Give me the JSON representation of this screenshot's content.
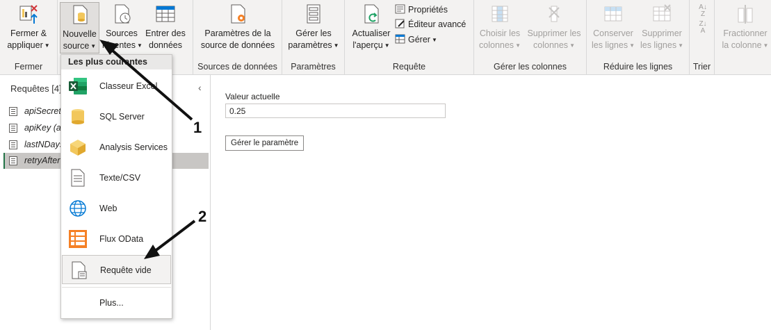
{
  "ribbon": {
    "groups": [
      {
        "label": "Fermer"
      },
      {
        "label": ""
      },
      {
        "label": "Sources de données"
      },
      {
        "label": "Paramètres"
      },
      {
        "label": "Requête"
      },
      {
        "label": "Gérer les colonnes"
      },
      {
        "label": "Réduire les lignes"
      },
      {
        "label": "Trier"
      }
    ],
    "close_apply": {
      "line1": "Fermer &",
      "line2": "appliquer"
    },
    "new_source": {
      "line1": "Nouvelle",
      "line2": "source"
    },
    "recent_sources": {
      "line1": "Sources",
      "line2": "récentes"
    },
    "enter_data": {
      "line1": "Entrer des",
      "line2": "données"
    },
    "ds_settings": {
      "line1": "Paramètres de la",
      "line2": "source de données"
    },
    "manage_params": {
      "line1": "Gérer les",
      "line2": "paramètres"
    },
    "refresh": {
      "line1": "Actualiser",
      "line2": "l'aperçu"
    },
    "properties": "Propriétés",
    "advanced_editor": "Éditeur avancé",
    "manage": "Gérer",
    "choose_cols": {
      "line1": "Choisir les",
      "line2": "colonnes"
    },
    "remove_cols": {
      "line1": "Supprimer les",
      "line2": "colonnes"
    },
    "keep_rows": {
      "line1": "Conserver",
      "line2": "les lignes"
    },
    "remove_rows": {
      "line1": "Supprimer",
      "line2": "les lignes"
    },
    "split_col": {
      "line1": "Fractionner",
      "line2": "la colonne"
    }
  },
  "queries_pane": {
    "title": "Requêtes [4]",
    "items": [
      {
        "label": "apiSecret ("
      },
      {
        "label": "apiKey (ap"
      },
      {
        "label": "lastNDays"
      },
      {
        "label": "retryAfter"
      }
    ]
  },
  "main": {
    "current_value_label": "Valeur actuelle",
    "current_value": "0.25",
    "manage_param_button": "Gérer le paramètre"
  },
  "dropdown": {
    "header": "Les plus courantes",
    "items": [
      {
        "label": "Classeur Excel",
        "icon": "excel-icon"
      },
      {
        "label": "SQL Server",
        "icon": "database-icon"
      },
      {
        "label": "Analysis Services",
        "icon": "cube-icon"
      },
      {
        "label": "Texte/CSV",
        "icon": "document-icon"
      },
      {
        "label": "Web",
        "icon": "globe-icon"
      },
      {
        "label": "Flux OData",
        "icon": "odata-icon"
      },
      {
        "label": "Requête vide",
        "icon": "blank-query-icon"
      },
      {
        "label": "Plus..."
      }
    ]
  },
  "annotations": {
    "one": "1",
    "two": "2"
  },
  "colors": {
    "accent": "#217346",
    "selected_bg": "#c8c6c4",
    "ribbon_bg": "#f3f2f1",
    "odata_orange": "#f58025",
    "excel_green": "#21a366",
    "database_yellow": "#f2c75c"
  }
}
